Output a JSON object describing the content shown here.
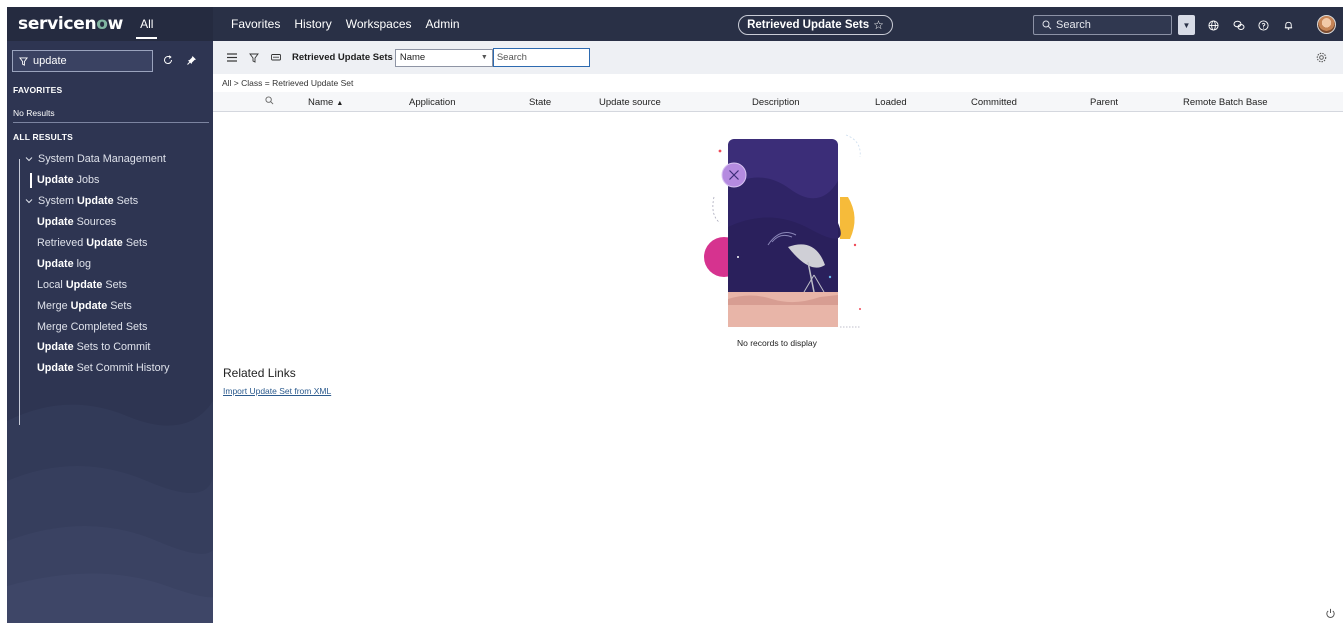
{
  "brand": {
    "logo_prefix": "servicen",
    "logo_o": "o",
    "logo_suffix": "w",
    "all_tab": "All"
  },
  "topnav": {
    "links": [
      "Favorites",
      "History",
      "Workspaces",
      "Admin"
    ],
    "context_title": "Retrieved Update Sets",
    "search_placeholder": "Search"
  },
  "sidebar": {
    "filter_value": "update",
    "favorites_label": "FAVORITES",
    "no_results": "No Results",
    "all_results_label": "ALL RESULTS",
    "items": [
      {
        "type": "group",
        "text": "System Data Management"
      },
      {
        "type": "item",
        "bold": "Update",
        "rest": "Jobs",
        "active": true
      },
      {
        "type": "group",
        "pre": "System",
        "bold": "Update",
        "rest": "Sets"
      },
      {
        "type": "item",
        "bold": "Update",
        "rest": "Sources"
      },
      {
        "type": "item",
        "pre": "Retrieved",
        "bold": "Update",
        "rest": "Sets"
      },
      {
        "type": "item",
        "bold": "Update",
        "rest": "log"
      },
      {
        "type": "item",
        "pre": "Local",
        "bold": "Update",
        "rest": "Sets"
      },
      {
        "type": "item",
        "pre": "Merge",
        "bold": "Update",
        "rest": "Sets"
      },
      {
        "type": "item",
        "pre": "Merge Completed Sets"
      },
      {
        "type": "item",
        "bold": "Update",
        "rest": "Sets to Commit"
      },
      {
        "type": "item",
        "bold": "Update",
        "rest": "Set Commit History"
      }
    ]
  },
  "list": {
    "title": "Retrieved Update Sets",
    "search_field": "Name",
    "search_placeholder": "Search",
    "breadcrumb": "All > Class = Retrieved Update Set",
    "columns": [
      "Name",
      "Application",
      "State",
      "Update source",
      "Description",
      "Loaded",
      "Committed",
      "Parent",
      "Remote Batch Base"
    ],
    "sort_indicator": "▲",
    "empty_message": "No records to display"
  },
  "related": {
    "title": "Related Links",
    "links": [
      "Import Update Set from XML"
    ]
  },
  "colors": {
    "nav_bg": "#293046",
    "sidebar_bg": "#2e3552",
    "toolbar_bg": "#eef0f4",
    "link": "#2c5b8e",
    "search_focus": "#2d6ab0"
  }
}
